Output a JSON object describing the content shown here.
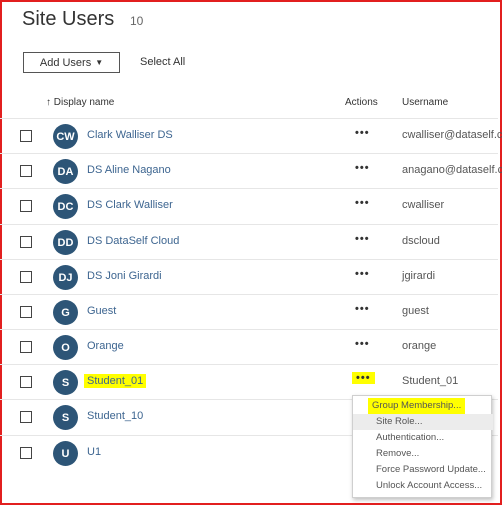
{
  "page": {
    "title": "Site Users",
    "count": "10"
  },
  "toolbar": {
    "add_users_label": "Add Users",
    "select_all_label": "Select All"
  },
  "columns": {
    "display_name": "↑ Display name",
    "actions": "Actions",
    "username": "Username"
  },
  "users": [
    {
      "initials": "CW",
      "name": "Clark Walliser DS",
      "username": "cwalliser@dataself.c"
    },
    {
      "initials": "DA",
      "name": "DS Aline Nagano",
      "username": "anagano@dataself.c"
    },
    {
      "initials": "DC",
      "name": "DS Clark Walliser",
      "username": "cwalliser"
    },
    {
      "initials": "DD",
      "name": "DS DataSelf Cloud",
      "username": "dscloud"
    },
    {
      "initials": "DJ",
      "name": "DS Joni Girardi",
      "username": "jgirardi"
    },
    {
      "initials": "G",
      "name": "Guest",
      "username": "guest"
    },
    {
      "initials": "O",
      "name": "Orange",
      "username": "orange"
    },
    {
      "initials": "S",
      "name": "Student_01",
      "username": "Student_01"
    },
    {
      "initials": "S",
      "name": "Student_10",
      "username": ""
    },
    {
      "initials": "U",
      "name": "U1",
      "username": ""
    }
  ],
  "actions_glyph": "•••",
  "context_menu": [
    "Group Membership...",
    "Site Role...",
    "Authentication...",
    "Remove...",
    "Force Password Update...",
    "Unlock Account Access..."
  ],
  "colors": {
    "avatar": "#2d5577",
    "highlight": "#ffff00",
    "link": "#3d6590",
    "frame": "#e21f1f"
  }
}
